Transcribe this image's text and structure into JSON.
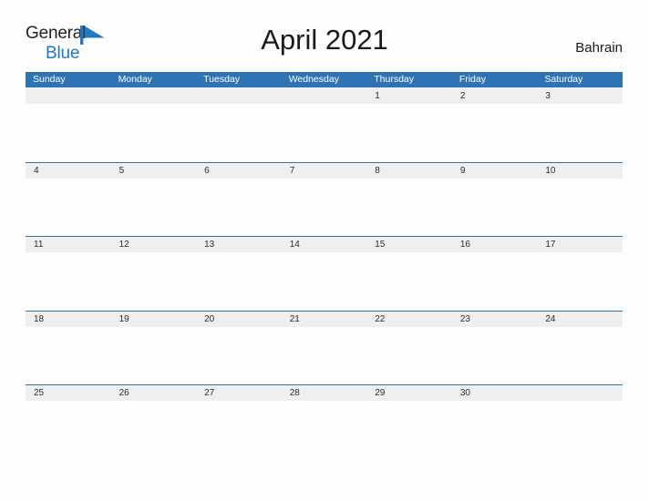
{
  "brand": {
    "logo_text_1": "General",
    "logo_text_2": "Blue",
    "logo_icon": "blue-triangle-flag-icon",
    "color_dark": "#231F20",
    "color_blue": "#1F7AC4"
  },
  "header": {
    "title": "April 2021",
    "month": "April",
    "year": "2021",
    "locale": "Bahrain"
  },
  "theme": {
    "header_blue": "#2E74B5",
    "date_band_gray": "#EFEFEF",
    "page_background": "#FDFDFD",
    "text_dark": "#2B2B2B",
    "header_text": "#FFFFFF"
  },
  "calendar": {
    "weekdays": [
      "Sunday",
      "Monday",
      "Tuesday",
      "Wednesday",
      "Thursday",
      "Friday",
      "Saturday"
    ],
    "weeks": [
      {
        "days": [
          "",
          "",
          "",
          "",
          "1",
          "2",
          "3"
        ]
      },
      {
        "days": [
          "4",
          "5",
          "6",
          "7",
          "8",
          "9",
          "10"
        ]
      },
      {
        "days": [
          "11",
          "12",
          "13",
          "14",
          "15",
          "16",
          "17"
        ]
      },
      {
        "days": [
          "18",
          "19",
          "20",
          "21",
          "22",
          "23",
          "24"
        ]
      },
      {
        "days": [
          "25",
          "26",
          "27",
          "28",
          "29",
          "30",
          ""
        ]
      }
    ]
  }
}
